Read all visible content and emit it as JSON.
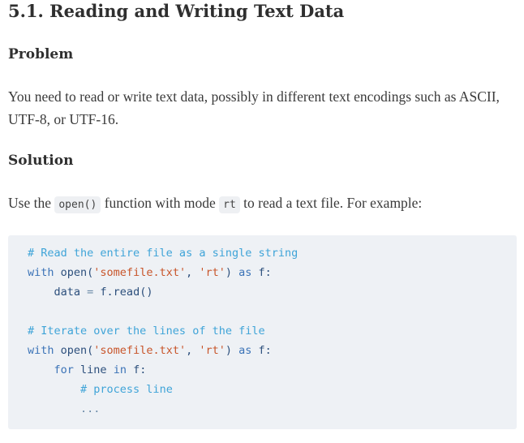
{
  "title": "5.1. Reading and Writing Text Data",
  "problem": {
    "heading": "Problem",
    "text": "You need to read or write text data, possibly in different text encodings such as ASCII, UTF-8, or UTF-16."
  },
  "solution": {
    "heading": "Solution",
    "text_before": "Use the ",
    "code_open": "open()",
    "text_middle": " function with mode ",
    "code_mode": "rt",
    "text_after": " to read a text file. For example:"
  },
  "code": {
    "line1_comment": "# Read the entire file as a single string",
    "line2_with": "with",
    "line2_open": " open(",
    "line2_str1": "'somefile.txt'",
    "line2_comma": ", ",
    "line2_str2": "'rt'",
    "line2_close": ") ",
    "line2_as": "as",
    "line2_f": " f:",
    "line3_indent": "    ",
    "line3_data": "data ",
    "line3_eq": "=",
    "line3_read": " f.read()",
    "line5_comment": "# Iterate over the lines of the file",
    "line6_with": "with",
    "line6_open": " open(",
    "line6_str1": "'somefile.txt'",
    "line6_comma": ", ",
    "line6_str2": "'rt'",
    "line6_close": ") ",
    "line6_as": "as",
    "line6_f": " f:",
    "line7_indent": "    ",
    "line7_for": "for",
    "line7_line": " line ",
    "line7_in": "in",
    "line7_f": " f:",
    "line8_indent": "        ",
    "line8_comment": "# process line",
    "line9_indent": "        ",
    "line9_dots": "..."
  }
}
